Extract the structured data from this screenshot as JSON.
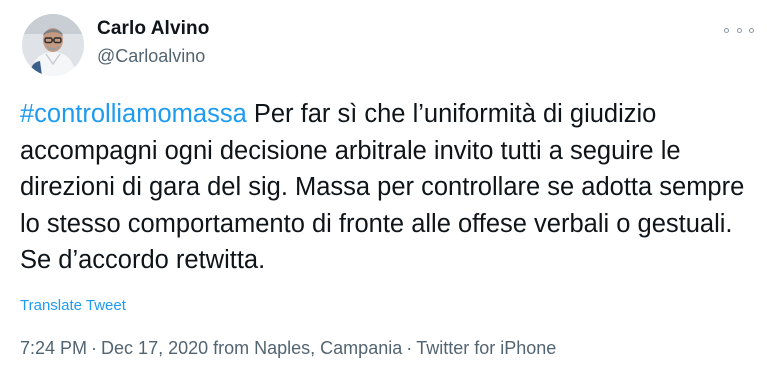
{
  "author": {
    "display_name": "Carlo Alvino",
    "handle": "@Carloalvino"
  },
  "tweet": {
    "hashtag": "#controlliamomassa",
    "body": " Per far sì che l’uniformità di giudizio accompagni ogni decisione arbitrale invito tutti a seguire le direzioni di gara del sig. Massa per controllare se adotta sempre lo stesso comportamento di fronte alle offese verbali o gestuali. Se d’accordo retwitta.",
    "translate_label": "Translate Tweet"
  },
  "meta": {
    "time": "7:24 PM",
    "date": "Dec 17, 2020",
    "location": "from Naples, Campania",
    "client": "Twitter for iPhone",
    "separator": "·"
  },
  "icons": {
    "more": "more-options-icon",
    "avatar": "profile-photo"
  },
  "colors": {
    "link": "#1d9bf0",
    "secondary_text": "#536471",
    "primary_text": "#0f1419"
  }
}
